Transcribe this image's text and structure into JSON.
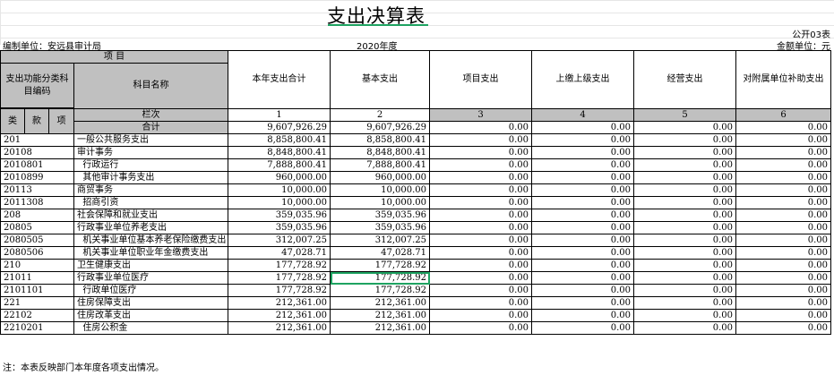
{
  "title": "支出决算表",
  "form_no": "公开03表",
  "unit_label": "编制单位：安远县审计局",
  "year": "2020年度",
  "amount_unit": "金额单位：元",
  "header": {
    "item": "项    目",
    "func_code": "支出功能分类科目编码",
    "subject_name": "科目名称",
    "cols": [
      "本年支出合计",
      "基本支出",
      "项目支出",
      "上缴上级支出",
      "经营支出",
      "对附属单位补助支出"
    ],
    "lei": "类",
    "kuan": "款",
    "xiang": "项",
    "lanci": "栏次",
    "col_nums": [
      "1",
      "2",
      "3",
      "4",
      "5",
      "6"
    ],
    "total_label": "合计"
  },
  "total_values": [
    "9,607,926.29",
    "9,607,926.29",
    "0.00",
    "0.00",
    "0.00",
    "0.00"
  ],
  "rows": [
    {
      "code": "201",
      "name": "一般公共服务支出",
      "values": [
        "8,858,800.41",
        "8,858,800.41",
        "0.00",
        "0.00",
        "0.00",
        "0.00"
      ]
    },
    {
      "code": "20108",
      "name": "审计事务",
      "values": [
        "8,848,800.41",
        "8,848,800.41",
        "0.00",
        "0.00",
        "0.00",
        "0.00"
      ]
    },
    {
      "code": "2010801",
      "name": "  行政运行",
      "values": [
        "7,888,800.41",
        "7,888,800.41",
        "0.00",
        "0.00",
        "0.00",
        "0.00"
      ]
    },
    {
      "code": "2010899",
      "name": "  其他审计事务支出",
      "values": [
        "960,000.00",
        "960,000.00",
        "0.00",
        "0.00",
        "0.00",
        "0.00"
      ]
    },
    {
      "code": "20113",
      "name": "商贸事务",
      "values": [
        "10,000.00",
        "10,000.00",
        "0.00",
        "0.00",
        "0.00",
        "0.00"
      ]
    },
    {
      "code": "2011308",
      "name": "  招商引资",
      "values": [
        "10,000.00",
        "10,000.00",
        "0.00",
        "0.00",
        "0.00",
        "0.00"
      ]
    },
    {
      "code": "208",
      "name": "社会保障和就业支出",
      "values": [
        "359,035.96",
        "359,035.96",
        "0.00",
        "0.00",
        "0.00",
        "0.00"
      ]
    },
    {
      "code": "20805",
      "name": "行政事业单位养老支出",
      "values": [
        "359,035.96",
        "359,035.96",
        "0.00",
        "0.00",
        "0.00",
        "0.00"
      ]
    },
    {
      "code": "2080505",
      "name": "  机关事业单位基本养老保险缴费支出",
      "small": true,
      "values": [
        "312,007.25",
        "312,007.25",
        "0.00",
        "0.00",
        "0.00",
        "0.00"
      ]
    },
    {
      "code": "2080506",
      "name": "  机关事业单位职业年金缴费支出",
      "values": [
        "47,028.71",
        "47,028.71",
        "0.00",
        "0.00",
        "0.00",
        "0.00"
      ]
    },
    {
      "code": "210",
      "name": "卫生健康支出",
      "values": [
        "177,728.92",
        "177,728.92",
        "0.00",
        "0.00",
        "0.00",
        "0.00"
      ]
    },
    {
      "code": "21011",
      "name": "行政事业单位医疗",
      "selected": true,
      "values": [
        "177,728.92",
        "177,728.92",
        "0.00",
        "0.00",
        "0.00",
        "0.00"
      ]
    },
    {
      "code": "2101101",
      "name": "  行政单位医疗",
      "values": [
        "177,728.92",
        "177,728.92",
        "0.00",
        "0.00",
        "0.00",
        "0.00"
      ]
    },
    {
      "code": "221",
      "name": "住房保障支出",
      "values": [
        "212,361.00",
        "212,361.00",
        "0.00",
        "0.00",
        "0.00",
        "0.00"
      ]
    },
    {
      "code": "22102",
      "name": "住房改革支出",
      "values": [
        "212,361.00",
        "212,361.00",
        "0.00",
        "0.00",
        "0.00",
        "0.00"
      ]
    },
    {
      "code": "2210201",
      "name": "  住房公积金",
      "values": [
        "212,361.00",
        "212,361.00",
        "0.00",
        "0.00",
        "0.00",
        "0.00"
      ]
    }
  ],
  "note": "注：本表反映部门本年度各项支出情况。"
}
